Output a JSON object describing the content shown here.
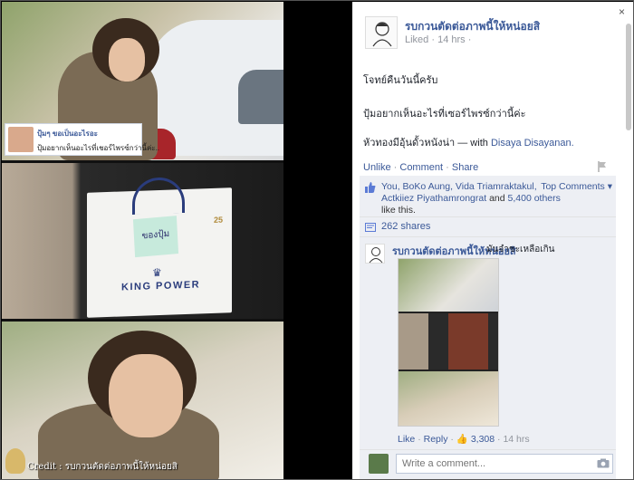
{
  "photo": {
    "comment_card": {
      "name": "ปุ้มๆ ขอเป็นอะไรอะ",
      "text": "ปุ้มอยากเห็นอะไรที่เชอร์ไพรซ์กว่านี้ค่ะ.."
    },
    "sticky_note": "ของปุ้ม",
    "bag_logo": "KING POWER",
    "bag_badge": "25",
    "credit": "Credit : รบกวนตัดต่อภาพนี้ให้หน่อยสิ"
  },
  "post": {
    "close_icon": "×",
    "page_name": "รบกวนตัดต่อภาพนี้ให้หน่อยสิ",
    "meta": "Liked · 14 hrs ·",
    "line1": "โจทย์คืนวันนี้ครับ",
    "line2": "ปุ้มอยากเห็นอะไรที่เซอร์ไพรซ์กว่านี้ค่ะ",
    "line3_prefix": "หัวทองมีอุ้นดั้วหนังน่า — with",
    "line3_tag": "Disaya Disayanan.",
    "actions": {
      "unlike": "Unlike",
      "comment": "Comment",
      "share": "Share"
    },
    "likes": {
      "names": "You, BoKo Aung, Vida Triamraktakul, Actkiiez Piyathamrongrat",
      "and": "and",
      "others": "5,400 others",
      "suffix": "like this.",
      "top_comments": "Top Comments ▾"
    },
    "shares": "262 shares",
    "comment": {
      "author": "รบกวนตัดต่อภาพนี้ให้หน่อยสิ",
      "text": "มันจำชะเหลือเกิน",
      "like": "Like",
      "reply": "Reply",
      "like_count": "3,308",
      "time": "14 hrs"
    },
    "write_placeholder": "Write a comment..."
  },
  "colors": {
    "fb_blue": "#3b5998",
    "ufi_bg": "#edeff4"
  },
  "icons": [
    "close-icon",
    "flag-icon",
    "like-thumb-icon",
    "share-icon",
    "camera-icon"
  ]
}
